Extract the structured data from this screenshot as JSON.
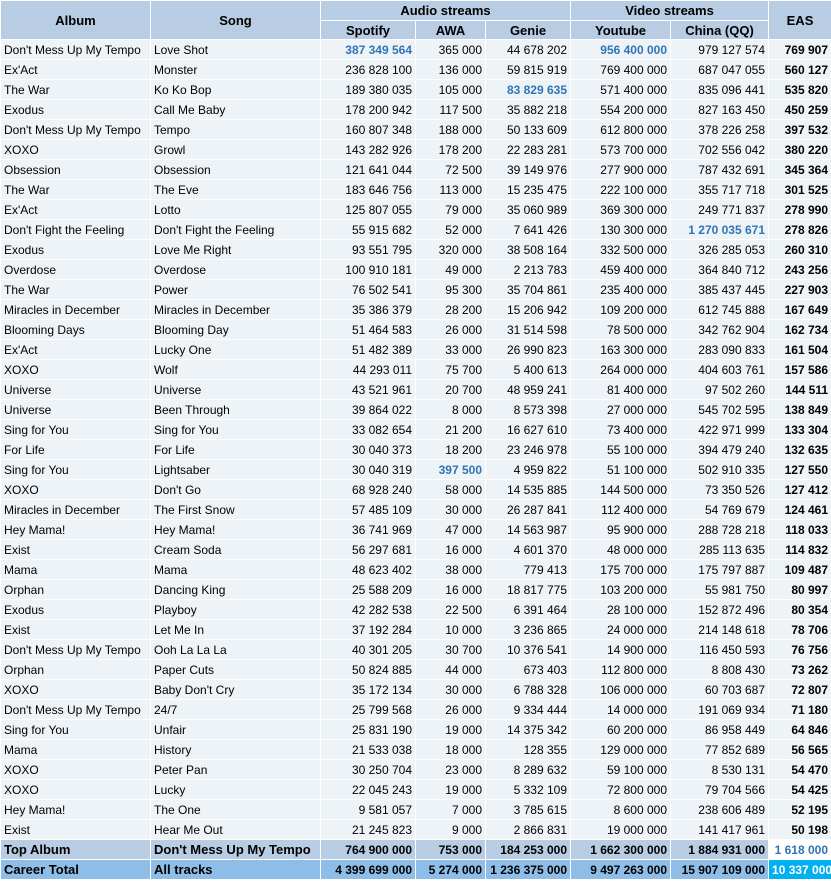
{
  "columns": {
    "album": "Album",
    "song": "Song",
    "audio_group": "Audio streams",
    "video_group": "Video streams",
    "eas": "EAS",
    "spotify": "Spotify",
    "awa": "AWA",
    "genie": "Genie",
    "youtube": "Youtube",
    "china": "China (QQ)"
  },
  "colors": {
    "header_bg": "#b8cce4",
    "row_bg": "#eef3f8",
    "highlight_text": "#2e75b6",
    "career_total_bg": "#8ebee8",
    "career_eas_bg": "#00b0f0"
  },
  "rows": [
    {
      "album": "Don't Mess Up My Tempo",
      "song": "Love Shot",
      "spotify": "387 349 564",
      "awa": "365 000",
      "genie": "44 678 202",
      "youtube": "956 400 000",
      "china": "979 127 574",
      "eas": "769 907",
      "hl": [
        "spotify",
        "youtube"
      ]
    },
    {
      "album": "Ex'Act",
      "song": "Monster",
      "spotify": "236 828 100",
      "awa": "136 000",
      "genie": "59 815 919",
      "youtube": "769 400 000",
      "china": "687 047 055",
      "eas": "560 127",
      "hl": []
    },
    {
      "album": "The War",
      "song": "Ko Ko Bop",
      "spotify": "189 380 035",
      "awa": "105 000",
      "genie": "83 829 635",
      "youtube": "571 400 000",
      "china": "835 096 441",
      "eas": "535 820",
      "hl": [
        "genie"
      ]
    },
    {
      "album": "Exodus",
      "song": "Call Me Baby",
      "spotify": "178 200 942",
      "awa": "117 500",
      "genie": "35 882 218",
      "youtube": "554 200 000",
      "china": "827 163 450",
      "eas": "450 259",
      "hl": []
    },
    {
      "album": "Don't Mess Up My Tempo",
      "song": "Tempo",
      "spotify": "160 807 348",
      "awa": "188 000",
      "genie": "50 133 609",
      "youtube": "612 800 000",
      "china": "378 226 258",
      "eas": "397 532",
      "hl": []
    },
    {
      "album": "XOXO",
      "song": "Growl",
      "spotify": "143 282 926",
      "awa": "178 200",
      "genie": "22 283 281",
      "youtube": "573 700 000",
      "china": "702 556 042",
      "eas": "380 220",
      "hl": []
    },
    {
      "album": "Obsession",
      "song": "Obsession",
      "spotify": "121 641 044",
      "awa": "72 500",
      "genie": "39 149 976",
      "youtube": "277 900 000",
      "china": "787 432 691",
      "eas": "345 364",
      "hl": []
    },
    {
      "album": "The War",
      "song": "The Eve",
      "spotify": "183 646 756",
      "awa": "113 000",
      "genie": "15 235 475",
      "youtube": "222 100 000",
      "china": "355 717 718",
      "eas": "301 525",
      "hl": []
    },
    {
      "album": "Ex'Act",
      "song": "Lotto",
      "spotify": "125 807 055",
      "awa": "79 000",
      "genie": "35 060 989",
      "youtube": "369 300 000",
      "china": "249 771 837",
      "eas": "278 990",
      "hl": []
    },
    {
      "album": "Don't Fight the Feeling",
      "song": "Don't Fight the Feeling",
      "spotify": "55 915 682",
      "awa": "52 000",
      "genie": "7 641 426",
      "youtube": "130 300 000",
      "china": "1 270 035 671",
      "eas": "278 826",
      "hl": [
        "china"
      ]
    },
    {
      "album": "Exodus",
      "song": "Love Me Right",
      "spotify": "93 551 795",
      "awa": "320 000",
      "genie": "38 508 164",
      "youtube": "332 500 000",
      "china": "326 285 053",
      "eas": "260 310",
      "hl": []
    },
    {
      "album": "Overdose",
      "song": "Overdose",
      "spotify": "100 910 181",
      "awa": "49 000",
      "genie": "2 213 783",
      "youtube": "459 400 000",
      "china": "364 840 712",
      "eas": "243 256",
      "hl": []
    },
    {
      "album": "The War",
      "song": "Power",
      "spotify": "76 502 541",
      "awa": "95 300",
      "genie": "35 704 861",
      "youtube": "235 400 000",
      "china": "385 437 445",
      "eas": "227 903",
      "hl": []
    },
    {
      "album": "Miracles in December",
      "song": "Miracles in December",
      "spotify": "35 386 379",
      "awa": "28 200",
      "genie": "15 206 942",
      "youtube": "109 200 000",
      "china": "612 745 888",
      "eas": "167 649",
      "hl": []
    },
    {
      "album": "Blooming Days",
      "song": "Blooming Day",
      "spotify": "51 464 583",
      "awa": "26 000",
      "genie": "31 514 598",
      "youtube": "78 500 000",
      "china": "342 762 904",
      "eas": "162 734",
      "hl": []
    },
    {
      "album": "Ex'Act",
      "song": "Lucky One",
      "spotify": "51 482 389",
      "awa": "33 000",
      "genie": "26 990 823",
      "youtube": "163 300 000",
      "china": "283 090 833",
      "eas": "161 504",
      "hl": []
    },
    {
      "album": "XOXO",
      "song": "Wolf",
      "spotify": "44 293 011",
      "awa": "75 700",
      "genie": "5 400 613",
      "youtube": "264 000 000",
      "china": "404 603 761",
      "eas": "157 586",
      "hl": []
    },
    {
      "album": "Universe",
      "song": "Universe",
      "spotify": "43 521 961",
      "awa": "20 700",
      "genie": "48 959 241",
      "youtube": "81 400 000",
      "china": "97 502 260",
      "eas": "144 511",
      "hl": []
    },
    {
      "album": "Universe",
      "song": "Been Through",
      "spotify": "39 864 022",
      "awa": "8 000",
      "genie": "8 573 398",
      "youtube": "27 000 000",
      "china": "545 702 595",
      "eas": "138 849",
      "hl": []
    },
    {
      "album": "Sing for You",
      "song": "Sing for You",
      "spotify": "33 082 654",
      "awa": "21 200",
      "genie": "16 627 610",
      "youtube": "73 400 000",
      "china": "422 971 999",
      "eas": "133 304",
      "hl": []
    },
    {
      "album": "For Life",
      "song": "For Life",
      "spotify": "30 040 373",
      "awa": "18 200",
      "genie": "23 246 978",
      "youtube": "55 100 000",
      "china": "394 479 240",
      "eas": "132 635",
      "hl": []
    },
    {
      "album": "Sing for You",
      "song": "Lightsaber",
      "spotify": "30 040 319",
      "awa": "397 500",
      "genie": "4 959 822",
      "youtube": "51 100 000",
      "china": "502 910 335",
      "eas": "127 550",
      "hl": [
        "awa"
      ]
    },
    {
      "album": "XOXO",
      "song": "Don't Go",
      "spotify": "68 928 240",
      "awa": "58 000",
      "genie": "14 535 885",
      "youtube": "144 500 000",
      "china": "73 350 526",
      "eas": "127 412",
      "hl": []
    },
    {
      "album": "Miracles in December",
      "song": "The First Snow",
      "spotify": "57 485 109",
      "awa": "30 000",
      "genie": "26 287 841",
      "youtube": "112 400 000",
      "china": "54 769 679",
      "eas": "124 461",
      "hl": []
    },
    {
      "album": "Hey Mama!",
      "song": "Hey Mama!",
      "spotify": "36 741 969",
      "awa": "47 000",
      "genie": "14 563 987",
      "youtube": "95 900 000",
      "china": "288 728 218",
      "eas": "118 033",
      "hl": []
    },
    {
      "album": "Exist",
      "song": "Cream Soda",
      "spotify": "56 297 681",
      "awa": "16 000",
      "genie": "4 601 370",
      "youtube": "48 000 000",
      "china": "285 113 635",
      "eas": "114 832",
      "hl": []
    },
    {
      "album": "Mama",
      "song": "Mama",
      "spotify": "48 623 402",
      "awa": "38 000",
      "genie": "779 413",
      "youtube": "175 700 000",
      "china": "175 797 887",
      "eas": "109 487",
      "hl": []
    },
    {
      "album": "Orphan",
      "song": "Dancing King",
      "spotify": "25 588 209",
      "awa": "16 000",
      "genie": "18 817 775",
      "youtube": "103 200 000",
      "china": "55 981 750",
      "eas": "80 997",
      "hl": []
    },
    {
      "album": "Exodus",
      "song": "Playboy",
      "spotify": "42 282 538",
      "awa": "22 500",
      "genie": "6 391 464",
      "youtube": "28 100 000",
      "china": "152 872 496",
      "eas": "80 354",
      "hl": []
    },
    {
      "album": "Exist",
      "song": "Let Me In",
      "spotify": "37 192 284",
      "awa": "10 000",
      "genie": "3 236 865",
      "youtube": "24 000 000",
      "china": "214 148 618",
      "eas": "78 706",
      "hl": []
    },
    {
      "album": "Don't Mess Up My Tempo",
      "song": "Ooh La La La",
      "spotify": "40 301 205",
      "awa": "30 700",
      "genie": "10 376 541",
      "youtube": "14 900 000",
      "china": "116 450 593",
      "eas": "76 756",
      "hl": []
    },
    {
      "album": "Orphan",
      "song": "Paper Cuts",
      "spotify": "50 824 885",
      "awa": "44 000",
      "genie": "673 403",
      "youtube": "112 800 000",
      "china": "8 808 430",
      "eas": "73 262",
      "hl": []
    },
    {
      "album": "XOXO",
      "song": "Baby Don't Cry",
      "spotify": "35 172 134",
      "awa": "30 000",
      "genie": "6 788 328",
      "youtube": "106 000 000",
      "china": "60 703 687",
      "eas": "72 807",
      "hl": []
    },
    {
      "album": "Don't Mess Up My Tempo",
      "song": "24/7",
      "spotify": "25 799 568",
      "awa": "26 000",
      "genie": "9 334 444",
      "youtube": "14 000 000",
      "china": "191 069 934",
      "eas": "71 180",
      "hl": []
    },
    {
      "album": "Sing for You",
      "song": "Unfair",
      "spotify": "25 831 190",
      "awa": "19 000",
      "genie": "14 375 342",
      "youtube": "60 200 000",
      "china": "86 958 449",
      "eas": "64 846",
      "hl": []
    },
    {
      "album": "Mama",
      "song": "History",
      "spotify": "21 533 038",
      "awa": "18 000",
      "genie": "128 355",
      "youtube": "129 000 000",
      "china": "77 852 689",
      "eas": "56 565",
      "hl": []
    },
    {
      "album": "XOXO",
      "song": "Peter Pan",
      "spotify": "30 250 704",
      "awa": "23 000",
      "genie": "8 289 632",
      "youtube": "59 100 000",
      "china": "8 530 131",
      "eas": "54 470",
      "hl": []
    },
    {
      "album": "XOXO",
      "song": "Lucky",
      "spotify": "22 045 243",
      "awa": "19 000",
      "genie": "5 332 109",
      "youtube": "72 800 000",
      "china": "79 704 566",
      "eas": "54 425",
      "hl": []
    },
    {
      "album": "Hey Mama!",
      "song": "The One",
      "spotify": "9 581 057",
      "awa": "7 000",
      "genie": "3 785 615",
      "youtube": "8 600 000",
      "china": "238 606 489",
      "eas": "52 195",
      "hl": []
    },
    {
      "album": "Exist",
      "song": "Hear Me Out",
      "spotify": "21 245 823",
      "awa": "9 000",
      "genie": "2 866 831",
      "youtube": "19 000 000",
      "china": "141 417 961",
      "eas": "50 198",
      "hl": []
    }
  ],
  "top_album": {
    "label": "Top Album",
    "song": "Don't Mess Up My Tempo",
    "spotify": "764 900 000",
    "awa": "753 000",
    "genie": "184 253 000",
    "youtube": "1 662 300 000",
    "china": "1 884 931 000",
    "eas": "1 618 000"
  },
  "career_total": {
    "label": "Career Total",
    "song": "All tracks",
    "spotify": "4 399 699 000",
    "awa": "5 274 000",
    "genie": "1 236 375 000",
    "youtube": "9 497 263 000",
    "china": "15 907 109 000",
    "eas": "10 337 000"
  }
}
